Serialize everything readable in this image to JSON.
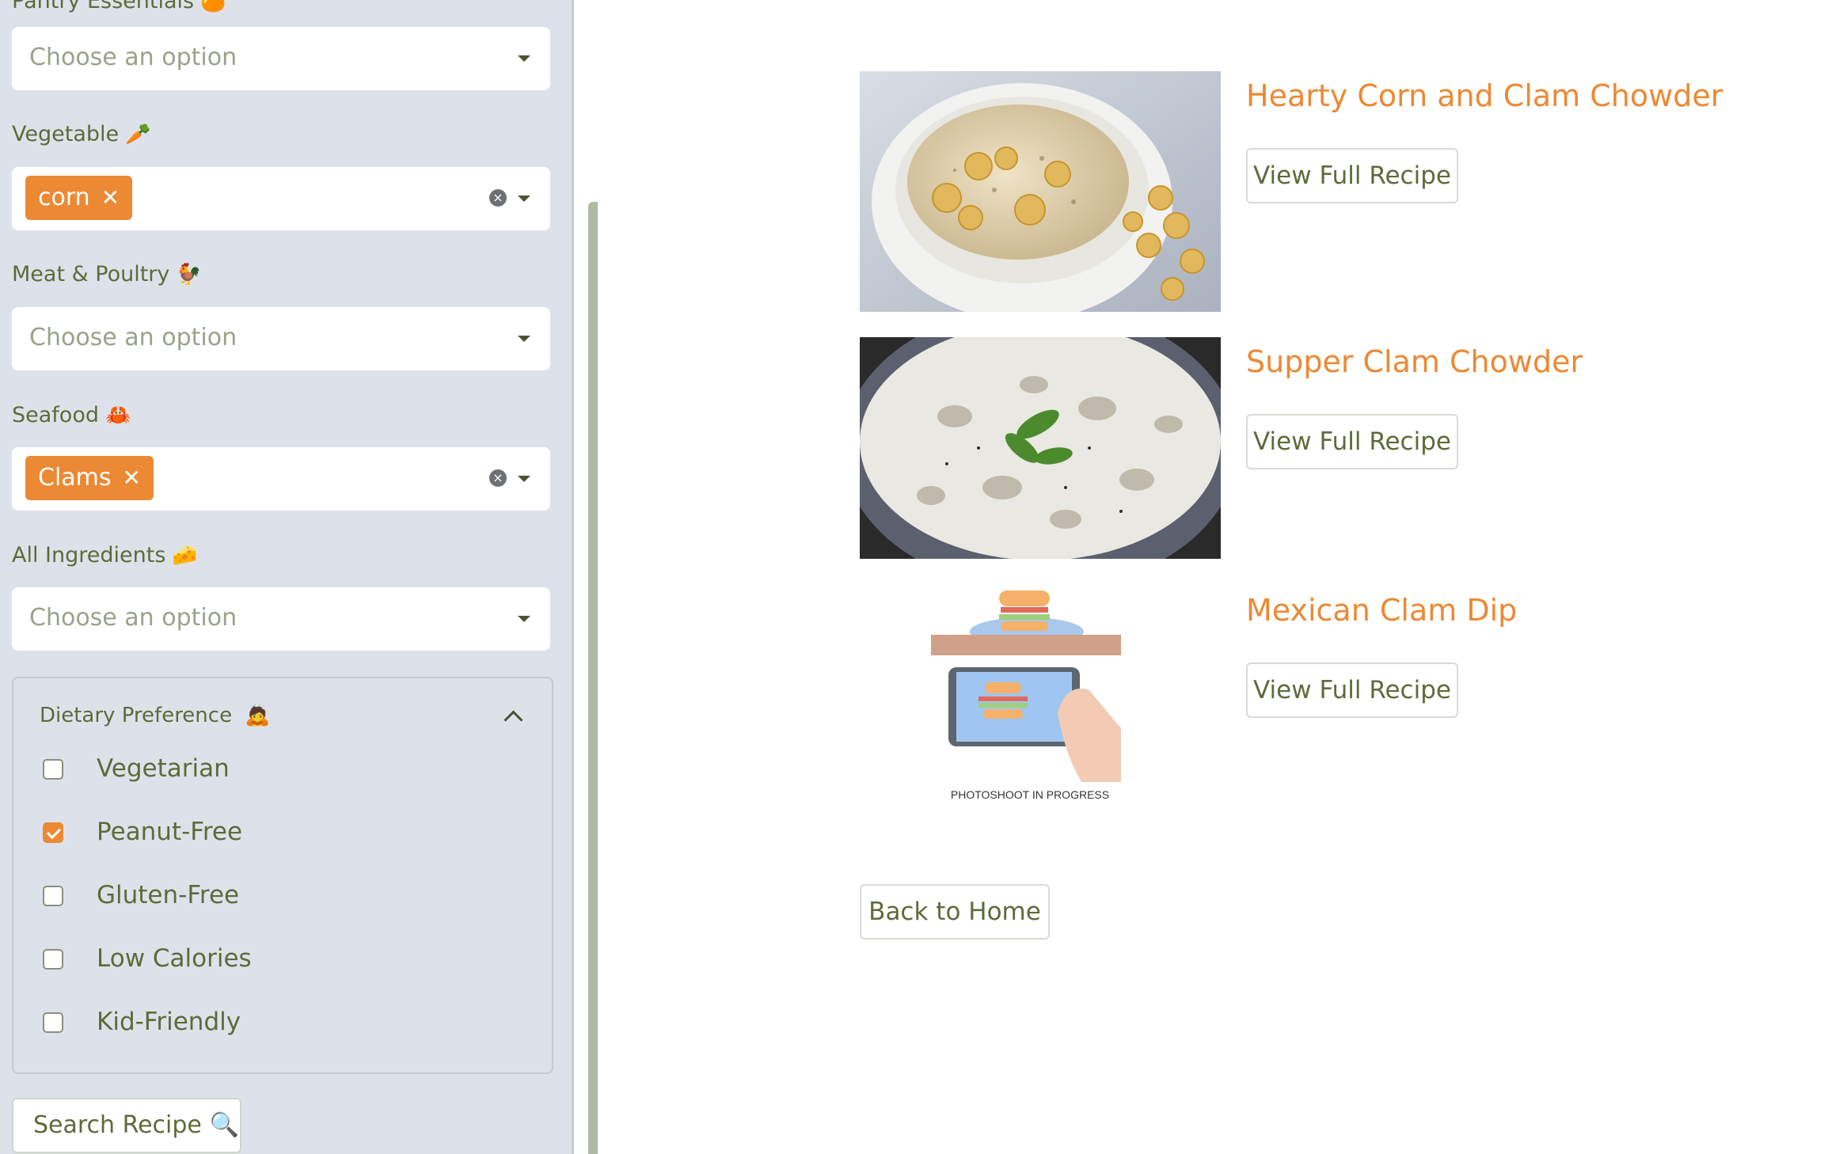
{
  "sidebar": {
    "pantry": {
      "label": "Pantry Essentials",
      "emoji": "🍊",
      "placeholder": "Choose an option"
    },
    "vegetable": {
      "label": "Vegetable",
      "emoji": "🥕",
      "tag": "corn"
    },
    "meat": {
      "label": "Meat & Poultry",
      "emoji": "🐓",
      "placeholder": "Choose an option"
    },
    "seafood": {
      "label": "Seafood",
      "emoji": "🦀",
      "tag": "Clams"
    },
    "all": {
      "label": "All Ingredients",
      "emoji": "🧀",
      "placeholder": "Choose an option"
    },
    "dietary": {
      "title": "Dietary Preference",
      "emoji": "🙇",
      "options": [
        {
          "label": "Vegetarian",
          "checked": false
        },
        {
          "label": "Peanut-Free",
          "checked": true
        },
        {
          "label": "Gluten-Free",
          "checked": false
        },
        {
          "label": "Low Calories",
          "checked": false
        },
        {
          "label": "Kid-Friendly",
          "checked": false
        }
      ]
    },
    "search_button": "Search Recipe",
    "search_emoji": "🔍"
  },
  "recipes": [
    {
      "title": "Hearty Corn and Clam Chowder",
      "button": "View Full Recipe"
    },
    {
      "title": "Supper Clam Chowder",
      "button": "View Full Recipe"
    },
    {
      "title": "Mexican Clam Dip",
      "button": "View Full Recipe",
      "image_caption": "PHOTOSHOOT IN PROGRESS"
    }
  ],
  "back_button": "Back to Home",
  "colors": {
    "accent": "#ec8934",
    "text": "#5d6b3a",
    "sidebar_bg": "#dde2ea"
  }
}
